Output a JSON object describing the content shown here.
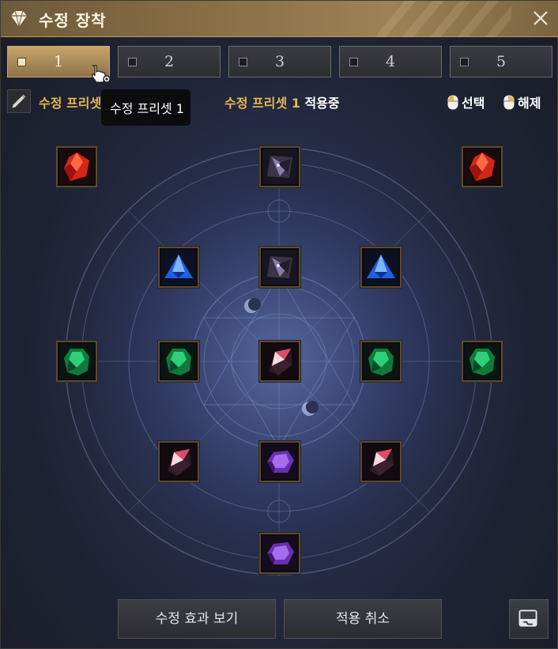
{
  "window": {
    "title": "수정 장착"
  },
  "tabs": [
    {
      "label": "1",
      "active": true
    },
    {
      "label": "2",
      "active": false
    },
    {
      "label": "3",
      "active": false
    },
    {
      "label": "4",
      "active": false
    },
    {
      "label": "5",
      "active": false
    }
  ],
  "preset": {
    "name_label": "수정 프리셋",
    "tooltip": "수정 프리셋 1",
    "applied_name": "수정 프리셋 1",
    "applied_suffix": "적용중"
  },
  "hints": {
    "select": "선택",
    "release": "해제"
  },
  "slots": [
    {
      "gem": "red-ruby-gem-icon",
      "special": true
    },
    {
      "gem": "dark-crystal-gem-icon",
      "special": false
    },
    {
      "gem": "red-ruby-gem-icon",
      "special": true
    },
    {
      "gem": "blue-trillion-gem-icon",
      "special": false
    },
    {
      "gem": "dark-crystal-gem-icon",
      "special": false
    },
    {
      "gem": "blue-trillion-gem-icon",
      "special": false
    },
    {
      "gem": "green-emerald-gem-icon",
      "special": false
    },
    {
      "gem": "green-emerald-gem-icon",
      "special": false
    },
    {
      "gem": "crimson-shard-gem-icon",
      "special": true
    },
    {
      "gem": "green-emerald-gem-icon",
      "special": false
    },
    {
      "gem": "green-emerald-gem-icon",
      "special": false
    },
    {
      "gem": "crimson-shard-gem-icon",
      "special": false
    },
    {
      "gem": "purple-amethyst-gem-icon",
      "special": false
    },
    {
      "gem": "crimson-shard-gem-icon",
      "special": false
    },
    {
      "gem": "purple-amethyst-gem-icon",
      "special": false
    }
  ],
  "buttons": {
    "view_effects": "수정 효과 보기",
    "cancel_apply": "적용 취소"
  },
  "colors": {
    "accent_gold": "#e9b84c",
    "title_bar": "#8a7046",
    "background": "#2a3252"
  }
}
